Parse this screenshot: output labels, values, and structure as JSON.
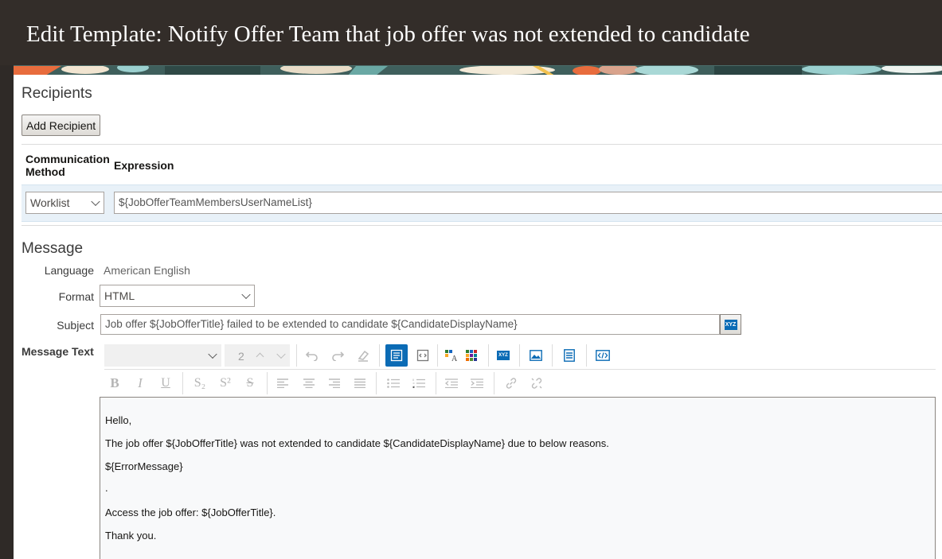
{
  "page": {
    "title": "Edit Template: Notify Offer Team that job offer was not extended to candidate"
  },
  "recipients": {
    "section_title": "Recipients",
    "add_button": "Add Recipient",
    "columns": [
      "Communication Method",
      "Expression"
    ],
    "rows": [
      {
        "method": "Worklist",
        "expression": "${JobOfferTeamMembersUserNameList}"
      }
    ]
  },
  "message": {
    "section_title": "Message",
    "language_label": "Language",
    "language_value": "American English",
    "format_label": "Format",
    "format_value": "HTML",
    "subject_label": "Subject",
    "subject_value": "Job offer ${JobOfferTitle} failed to be extended to candidate ${CandidateDisplayName}",
    "message_text_label": "Message Text",
    "font_size_value": "2",
    "body_lines": [
      "Hello,",
      "The job offer ${JobOfferTitle} was not extended to candidate ${CandidateDisplayName} due to below reasons.",
      "${ErrorMessage}",
      ".",
      "Access the job offer: ${JobOfferTitle}.",
      "Thank you."
    ]
  },
  "icons": {
    "bold": "B",
    "italic": "I",
    "underline": "U",
    "subscript": "S₂",
    "superscript": "S²",
    "strike": "S",
    "variable": "XYZ"
  },
  "colors": {
    "title_bar": "#332d29",
    "accent_blue": "#0b6bb5",
    "row_highlight": "#e8f1f8"
  }
}
